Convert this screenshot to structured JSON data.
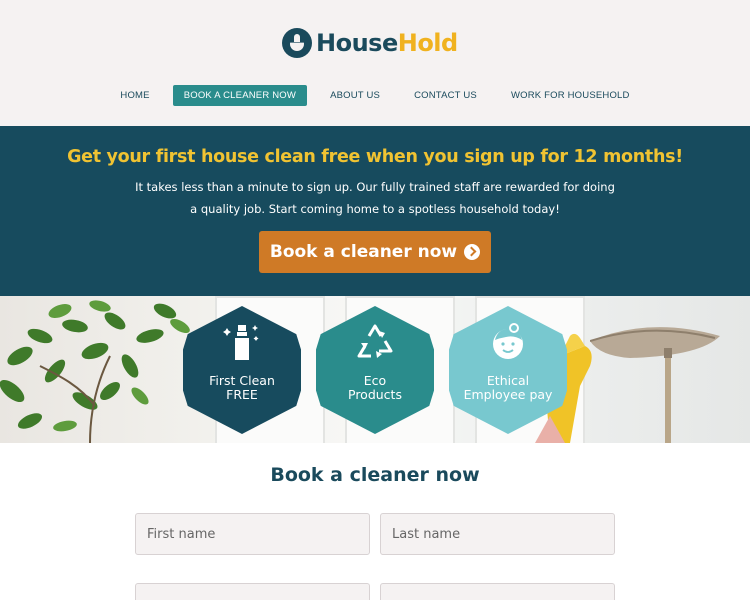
{
  "brand": {
    "name_part1": "House",
    "name_part2": "Hold"
  },
  "nav": {
    "items": [
      {
        "label": "HOME",
        "active": false
      },
      {
        "label": "BOOK A CLEANER NOW",
        "active": true
      },
      {
        "label": "ABOUT US",
        "active": false
      },
      {
        "label": "CONTACT US",
        "active": false
      },
      {
        "label": "WORK FOR HOUSEHOLD",
        "active": false
      }
    ]
  },
  "hero": {
    "title": "Get your first house clean free when you sign up for 12 months!",
    "text": "It takes less than a minute to sign up. Our fully trained staff are rewarded for doing a quality job. Start coming home to a spotless household today!",
    "cta_label": "Book a cleaner now"
  },
  "features": [
    {
      "line1": "First Clean",
      "line2": "FREE",
      "icon": "spray-bottle-icon"
    },
    {
      "line1": "Eco",
      "line2": "Products",
      "icon": "recycle-icon"
    },
    {
      "line1": "Ethical",
      "line2": "Employee pay",
      "icon": "employee-face-icon"
    }
  ],
  "form": {
    "title": "Book a cleaner now",
    "first_name_placeholder": "First name",
    "last_name_placeholder": "Last name"
  },
  "colors": {
    "navy": "#174b5e",
    "teal": "#2a8c8c",
    "light_teal": "#78c8cf",
    "yellow": "#f0c332",
    "orange": "#cf7a26"
  }
}
